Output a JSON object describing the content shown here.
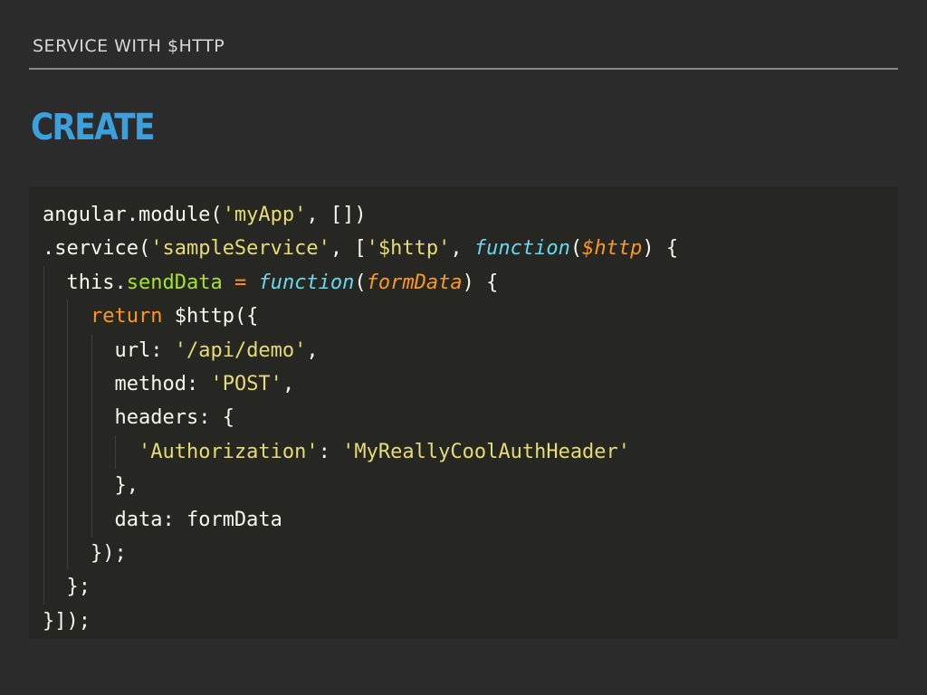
{
  "header": {
    "label": "SERVICE WITH $HTTP"
  },
  "slide": {
    "title": "CREATE"
  },
  "colors": {
    "background": "#2b2b2b",
    "code_background": "#262622",
    "title": "#3ba0db",
    "string": "#e6db74",
    "keyword": "#fd971f",
    "function": "#66d9ef",
    "property": "#a6e22e"
  },
  "code": {
    "lines": [
      {
        "indent": 0,
        "tokens": [
          {
            "type": "plain",
            "text": "angular.module("
          },
          {
            "type": "string",
            "text": "'myApp'"
          },
          {
            "type": "plain",
            "text": ", [])"
          }
        ]
      },
      {
        "indent": 0,
        "tokens": [
          {
            "type": "plain",
            "text": ".service("
          },
          {
            "type": "string",
            "text": "'sampleService'"
          },
          {
            "type": "plain",
            "text": ", ["
          },
          {
            "type": "string",
            "text": "'$http'"
          },
          {
            "type": "plain",
            "text": ", "
          },
          {
            "type": "func",
            "text": "function"
          },
          {
            "type": "plain",
            "text": "("
          },
          {
            "type": "param",
            "text": "$http"
          },
          {
            "type": "plain",
            "text": ") {"
          }
        ]
      },
      {
        "indent": 1,
        "tokens": [
          {
            "type": "plain",
            "text": "this."
          },
          {
            "type": "prop",
            "text": "sendData"
          },
          {
            "type": "plain",
            "text": " "
          },
          {
            "type": "keyword",
            "text": "="
          },
          {
            "type": "plain",
            "text": " "
          },
          {
            "type": "func",
            "text": "function"
          },
          {
            "type": "plain",
            "text": "("
          },
          {
            "type": "param",
            "text": "formData"
          },
          {
            "type": "plain",
            "text": ") {"
          }
        ]
      },
      {
        "indent": 2,
        "tokens": [
          {
            "type": "keyword",
            "text": "return"
          },
          {
            "type": "plain",
            "text": " $http({"
          }
        ]
      },
      {
        "indent": 3,
        "tokens": [
          {
            "type": "plain",
            "text": "url: "
          },
          {
            "type": "string",
            "text": "'/api/demo'"
          },
          {
            "type": "plain",
            "text": ","
          }
        ]
      },
      {
        "indent": 3,
        "tokens": [
          {
            "type": "plain",
            "text": "method: "
          },
          {
            "type": "string",
            "text": "'POST'"
          },
          {
            "type": "plain",
            "text": ","
          }
        ]
      },
      {
        "indent": 3,
        "tokens": [
          {
            "type": "plain",
            "text": "headers: {"
          }
        ]
      },
      {
        "indent": 4,
        "tokens": [
          {
            "type": "string",
            "text": "'Authorization'"
          },
          {
            "type": "plain",
            "text": ": "
          },
          {
            "type": "string",
            "text": "'MyReallyCoolAuthHeader'"
          }
        ]
      },
      {
        "indent": 3,
        "tokens": [
          {
            "type": "plain",
            "text": "},"
          }
        ]
      },
      {
        "indent": 3,
        "tokens": [
          {
            "type": "plain",
            "text": "data: formData"
          }
        ]
      },
      {
        "indent": 2,
        "tokens": [
          {
            "type": "plain",
            "text": "});"
          }
        ]
      },
      {
        "indent": 1,
        "tokens": [
          {
            "type": "plain",
            "text": "};"
          }
        ]
      },
      {
        "indent": 0,
        "tokens": [
          {
            "type": "plain",
            "text": "}]);"
          }
        ]
      }
    ]
  }
}
